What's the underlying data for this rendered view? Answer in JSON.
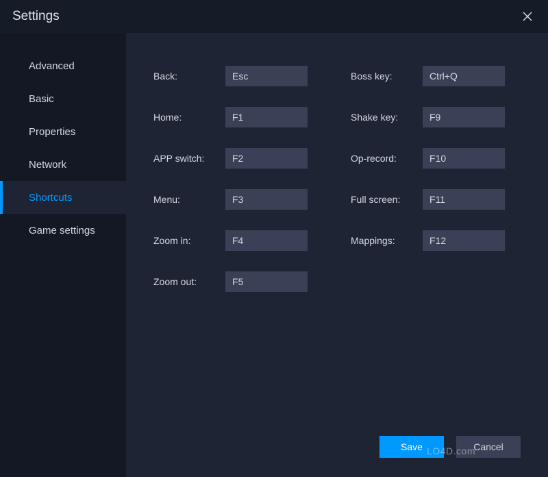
{
  "title": "Settings",
  "sidebar": {
    "items": [
      {
        "label": "Advanced",
        "active": false
      },
      {
        "label": "Basic",
        "active": false
      },
      {
        "label": "Properties",
        "active": false
      },
      {
        "label": "Network",
        "active": false
      },
      {
        "label": "Shortcuts",
        "active": true
      },
      {
        "label": "Game settings",
        "active": false
      }
    ]
  },
  "shortcuts": {
    "left": [
      {
        "label": "Back:",
        "value": "Esc",
        "name": "back"
      },
      {
        "label": "Home:",
        "value": "F1",
        "name": "home"
      },
      {
        "label": "APP switch:",
        "value": "F2",
        "name": "app-switch"
      },
      {
        "label": "Menu:",
        "value": "F3",
        "name": "menu"
      },
      {
        "label": "Zoom in:",
        "value": "F4",
        "name": "zoom-in"
      },
      {
        "label": "Zoom out:",
        "value": "F5",
        "name": "zoom-out"
      }
    ],
    "right": [
      {
        "label": "Boss key:",
        "value": "Ctrl+Q",
        "name": "boss-key"
      },
      {
        "label": "Shake key:",
        "value": "F9",
        "name": "shake-key"
      },
      {
        "label": "Op-record:",
        "value": "F10",
        "name": "op-record"
      },
      {
        "label": "Full screen:",
        "value": "F11",
        "name": "full-screen"
      },
      {
        "label": "Mappings:",
        "value": "F12",
        "name": "mappings"
      }
    ]
  },
  "buttons": {
    "save": "Save",
    "cancel": "Cancel"
  },
  "watermark": "LO4D.com"
}
